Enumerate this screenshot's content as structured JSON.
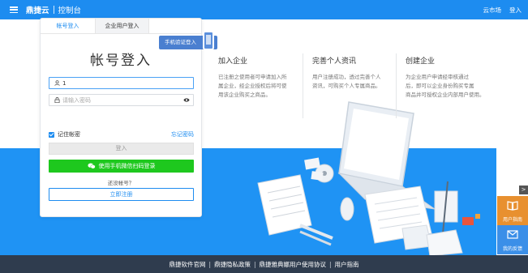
{
  "header": {
    "brand": "鼎捷云",
    "subtitle": "控制台",
    "links": [
      "云市场",
      "登入"
    ]
  },
  "login": {
    "tabs": [
      "帐号登入",
      "企业用户登入"
    ],
    "title": "帐号登入",
    "sms_tag": "手机验证登入",
    "username_value": "1",
    "password_placeholder": "请输入密码",
    "remember_label": "记住帐密",
    "remember_checked": true,
    "forgot_label": "忘记密码",
    "login_button": "登入",
    "wechat_button": "使用手机微信扫码登录",
    "no_account_text": "还没帐号？",
    "register_button": "立即注册"
  },
  "features": [
    {
      "title": "加入企业",
      "desc_lines": [
        "已注册之使用者可申请加入所",
        "属企业，经企业授权后将可使",
        "用该企业购买之商品。"
      ]
    },
    {
      "title": "完善个人资讯",
      "desc_lines": [
        "用户注册成功，透过完善个人",
        "资讯，可购买个人专属商品。"
      ]
    },
    {
      "title": "创建企业",
      "desc_lines": [
        "为企业用户申请经审核通过",
        "后，即可以企业身份购买专属",
        "商品并可授权企业内部用户使用。"
      ]
    }
  ],
  "side": {
    "arrow": ">",
    "guide_label": "用户指南",
    "feedback_label": "我的反馈"
  },
  "footer": {
    "links": [
      "鼎捷软件官网",
      "鼎捷隐私政策",
      "鼎捷雅典娜用户使用协议",
      "用户指南"
    ]
  },
  "colors": {
    "primary": "#1d8cf0",
    "topbar": "#1d8cf0",
    "band": "#1f93f4",
    "footer": "#2f3c4e",
    "wechat": "#1ec81e",
    "guide": "#e8902f",
    "feedback": "#3b8fe8"
  },
  "icons": [
    "menu-icon",
    "user-icon",
    "lock-icon",
    "eye-icon",
    "wechat-icon",
    "phone-icon",
    "book-icon",
    "mail-icon"
  ]
}
